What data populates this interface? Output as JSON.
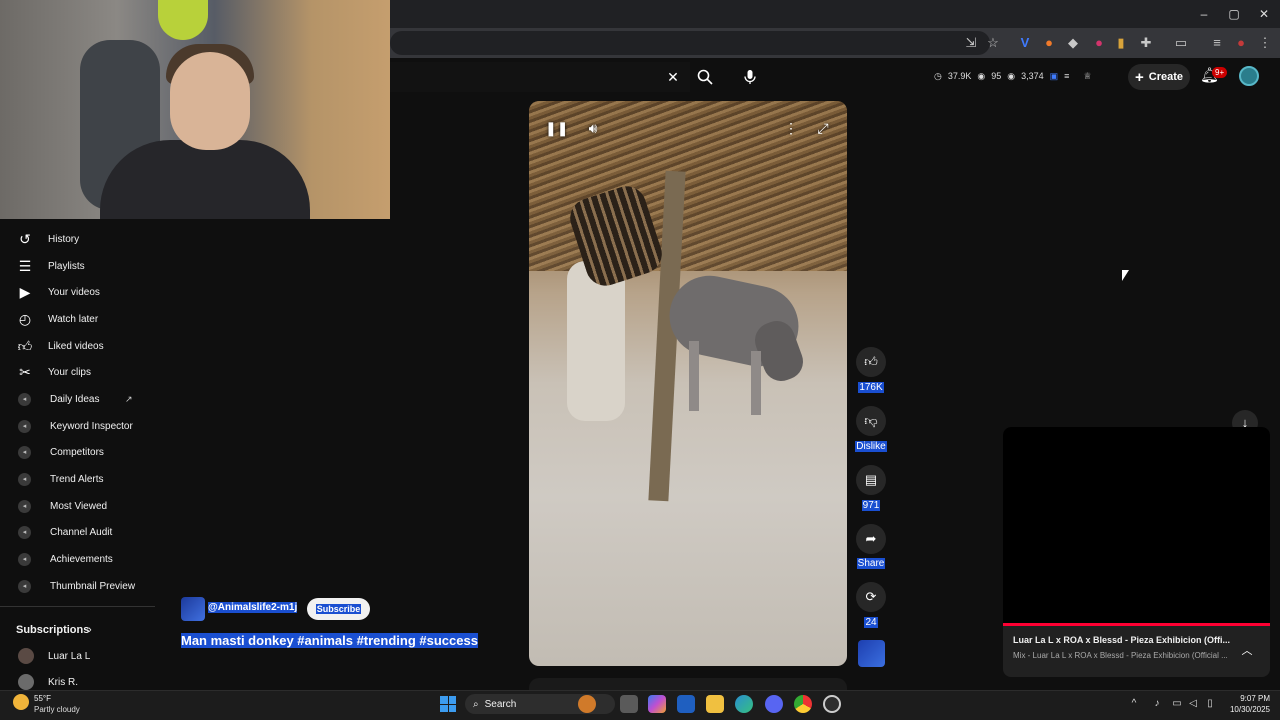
{
  "header": {
    "stats": {
      "views": "37.9K",
      "likes": "95",
      "subscribers": "3,374"
    },
    "create_label": "Create",
    "notification_count": "9+"
  },
  "sidebar": {
    "items": [
      {
        "label": "History",
        "icon": "history-icon"
      },
      {
        "label": "Playlists",
        "icon": "playlists-icon"
      },
      {
        "label": "Your videos",
        "icon": "your-videos-icon"
      },
      {
        "label": "Watch later",
        "icon": "clock-icon"
      },
      {
        "label": "Liked videos",
        "icon": "thumbs-up-icon"
      },
      {
        "label": "Your clips",
        "icon": "scissors-icon"
      },
      {
        "label": "Daily Ideas",
        "icon": "extension-icon"
      },
      {
        "label": "Keyword Inspector",
        "icon": "extension-icon"
      },
      {
        "label": "Competitors",
        "icon": "extension-icon"
      },
      {
        "label": "Trend Alerts",
        "icon": "extension-icon"
      },
      {
        "label": "Most Viewed",
        "icon": "extension-icon"
      },
      {
        "label": "Channel Audit",
        "icon": "extension-icon"
      },
      {
        "label": "Achievements",
        "icon": "extension-icon"
      },
      {
        "label": "Thumbnail Preview",
        "icon": "extension-icon"
      }
    ],
    "subscriptions_heading": "Subscriptions",
    "subscriptions": [
      {
        "label": "Luar La L"
      },
      {
        "label": "Kris R."
      }
    ]
  },
  "short": {
    "channel": "@Animalslife2-m1j",
    "subscribe_label": "Subscribe",
    "title": "Man masti donkey #animals #trending #success",
    "likes": "176K",
    "dislike_label": "Dislike",
    "comments": "971",
    "share_label": "Share",
    "remix": "24"
  },
  "miniplayer": {
    "title": "Luar La L x ROA x Blessd - Pieza Exhibicion (Offi...",
    "subtitle": "Mix - Luar La L x ROA x Blessd - Pieza Exhibicion (Official ..."
  },
  "taskbar": {
    "weather_temp": "55°F",
    "weather_desc": "Partly cloudy",
    "search_label": "Search",
    "time": "9:07 PM",
    "date": "10/30/2025"
  },
  "colors": {
    "background": "#0f0f0f",
    "selection": "#1a4fd1",
    "accent_red": "#ff0033"
  }
}
